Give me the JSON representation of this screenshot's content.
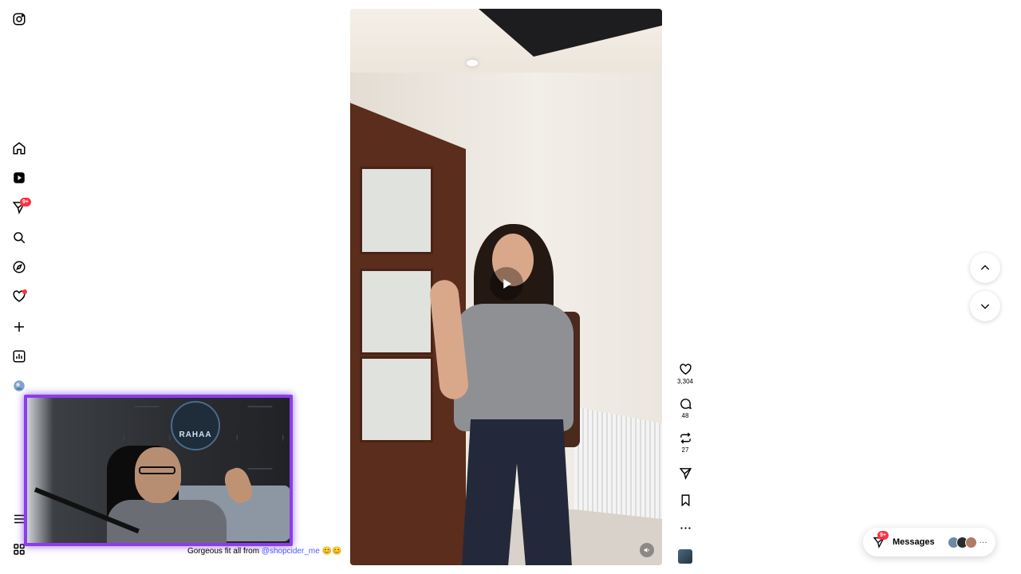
{
  "sidebar": {
    "items": [
      {
        "name": "instagram-logo-icon"
      },
      {
        "name": "home-icon"
      },
      {
        "name": "reels-icon"
      },
      {
        "name": "messages-icon",
        "badge": "9+"
      },
      {
        "name": "search-icon"
      },
      {
        "name": "explore-icon"
      },
      {
        "name": "notifications-icon"
      },
      {
        "name": "create-icon"
      },
      {
        "name": "dashboard-icon"
      },
      {
        "name": "profile-avatar"
      },
      {
        "name": "more-menu-icon"
      },
      {
        "name": "also-from-meta-icon"
      }
    ]
  },
  "reel": {
    "caption_text": "Gorgeous fit all from ",
    "caption_handle": "@shopcider_me",
    "caption_emoji": "😊😊"
  },
  "actions": {
    "likes": "3,304",
    "comments": "48",
    "reposts": "27"
  },
  "messages": {
    "label": "Messages",
    "badge": "9+",
    "more": "···"
  },
  "webcam": {
    "logo_text": "RAHAA"
  },
  "colors": {
    "badge_red": "#ff3040",
    "link_blue": "#4a5df9",
    "webcam_border": "#8a3ee8"
  }
}
